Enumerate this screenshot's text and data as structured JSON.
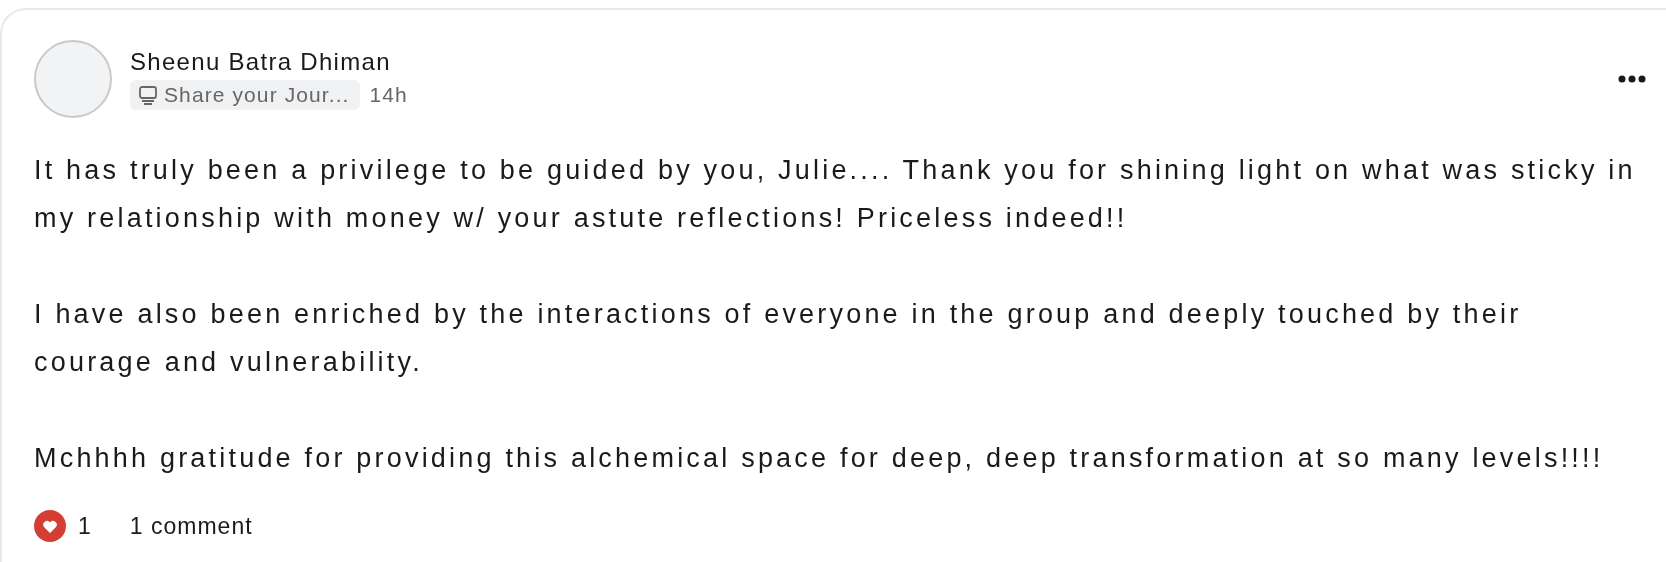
{
  "post": {
    "author": "Sheenu Batra Dhiman",
    "channel": "Share your Jour...",
    "time": "14h",
    "paragraphs": [
      "It has truly been a privilege to be guided by you, Julie.... Thank you for shining light on what was sticky in my relationship with money w/ your astute reflections! Priceless indeed!!",
      "I have also been enriched by the interactions of everyone in the group and deeply touched by their courage and vulnerability.",
      "Mchhhh gratitude for providing this alchemical space for deep, deep transformation at so many levels!!!!"
    ],
    "likes": "1",
    "liked": true,
    "comments": "1 comment"
  }
}
